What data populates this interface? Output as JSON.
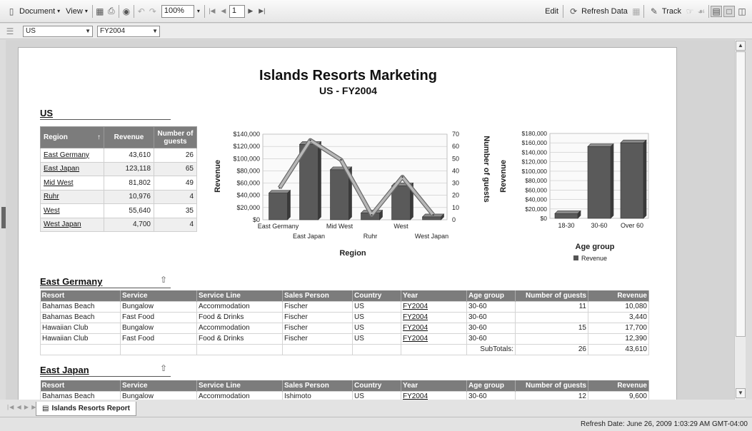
{
  "toolbar": {
    "document": "Document",
    "view": "View",
    "zoom": "100%",
    "page": "1",
    "edit": "Edit",
    "refresh": "Refresh Data",
    "track": "Track"
  },
  "filters": {
    "country": "US",
    "year": "FY2004"
  },
  "report": {
    "title": "Islands Resorts Marketing",
    "subtitle": "US - FY2004",
    "section_us": "US",
    "summary": {
      "headers": [
        "Region",
        "Revenue",
        "Number of guests"
      ],
      "rows": [
        {
          "region": "East Germany",
          "revenue": "43,610",
          "guests": "26"
        },
        {
          "region": "East Japan",
          "revenue": "123,118",
          "guests": "65"
        },
        {
          "region": "Mid West",
          "revenue": "81,802",
          "guests": "49"
        },
        {
          "region": "Ruhr",
          "revenue": "10,976",
          "guests": "4"
        },
        {
          "region": "West",
          "revenue": "55,640",
          "guests": "35"
        },
        {
          "region": "West Japan",
          "revenue": "4,700",
          "guests": "4"
        }
      ]
    },
    "detail_headers": [
      "Resort",
      "Service",
      "Service Line",
      "Sales Person",
      "Country",
      "Year",
      "Age group",
      "Number of guests",
      "Revenue"
    ],
    "east_germany": {
      "title": "East Germany",
      "rows": [
        [
          "Bahamas Beach",
          "Bungalow",
          "Accommodation",
          "Fischer",
          "US",
          "FY2004",
          "30-60",
          "11",
          "10,080"
        ],
        [
          "Bahamas Beach",
          "Fast Food",
          "Food & Drinks",
          "Fischer",
          "US",
          "FY2004",
          "30-60",
          "",
          "3,440"
        ],
        [
          "Hawaiian Club",
          "Bungalow",
          "Accommodation",
          "Fischer",
          "US",
          "FY2004",
          "30-60",
          "15",
          "17,700"
        ],
        [
          "Hawaiian Club",
          "Fast Food",
          "Food & Drinks",
          "Fischer",
          "US",
          "FY2004",
          "30-60",
          "",
          "12,390"
        ]
      ],
      "subtotal_label": "SubTotals:",
      "subtotal_guests": "26",
      "subtotal_revenue": "43,610"
    },
    "east_japan": {
      "title": "East Japan",
      "rows": [
        [
          "Bahamas Beach",
          "Bungalow",
          "Accommodation",
          "Ishimoto",
          "US",
          "FY2004",
          "30-60",
          "12",
          "9,600"
        ]
      ]
    }
  },
  "chart_data": [
    {
      "type": "bar",
      "categories": [
        "East Germany",
        "East Japan",
        "Mid West",
        "Ruhr",
        "West",
        "West Japan"
      ],
      "series": [
        {
          "name": "Revenue",
          "type": "bar",
          "axis": "left",
          "values": [
            43610,
            123118,
            81802,
            10976,
            55640,
            4700
          ]
        },
        {
          "name": "Number of guests",
          "type": "line",
          "axis": "right",
          "values": [
            26,
            65,
            49,
            4,
            35,
            4
          ]
        }
      ],
      "xlabel": "Region",
      "ylabel": "Revenue",
      "y2label": "Number of guests",
      "ylim": [
        0,
        140000
      ],
      "y2lim": [
        0,
        70
      ],
      "yticks": [
        "$0",
        "$20,000",
        "$40,000",
        "$60,000",
        "$80,000",
        "$100,000",
        "$120,000",
        "$140,000"
      ],
      "y2ticks": [
        "0",
        "10",
        "20",
        "30",
        "40",
        "50",
        "60",
        "70"
      ],
      "grid": true
    },
    {
      "type": "bar",
      "categories": [
        "18-30",
        "30-60",
        "Over 60"
      ],
      "series": [
        {
          "name": "Revenue",
          "values": [
            10000,
            152000,
            160000
          ]
        }
      ],
      "xlabel": "Age group",
      "ylabel": "Revenue",
      "ylim": [
        0,
        180000
      ],
      "yticks": [
        "$0",
        "$20,000",
        "$40,000",
        "$60,000",
        "$80,000",
        "$100,000",
        "$120,000",
        "$140,000",
        "$160,000",
        "$180,000"
      ],
      "legend": "Revenue",
      "grid": true
    }
  ],
  "bottom": {
    "tab": "Islands Resorts Report",
    "status": "Refresh Date: June 26, 2009 1:03:29 AM GMT-04:00"
  }
}
